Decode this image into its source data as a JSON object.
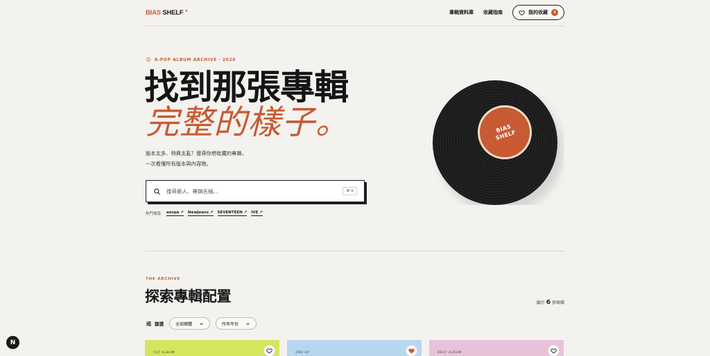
{
  "header": {
    "logo_a": "BIAS",
    "logo_b": "SHELF",
    "logo_dot": "●",
    "nav": [
      "專輯資料庫",
      "收藏指南"
    ],
    "favorites_label": "我的收藏",
    "favorites_count": "1"
  },
  "hero": {
    "eyebrow": "K-POP ALBUM ARCHIVE · 2026",
    "title_line1": "找到那張專輯",
    "title_line2": "完整的樣子。",
    "subtitle_line1": "版本太多、特典太亂？搜尋你想收藏的專輯，",
    "subtitle_line2": "一次看懂所有版本與內容物。",
    "search_placeholder": "搜尋藝人、專輯名稱...",
    "search_shortcut": "⌘ K",
    "popular_label": "熱門搜尋",
    "popular_tags": [
      "aespa ↗",
      "NewJeans ↗",
      "SEVENTEEN ↗",
      "IVE ↗"
    ],
    "vinyl_label_line1": "BIAS",
    "vinyl_label_line2": "SHELF"
  },
  "archive": {
    "eyebrow": "THE ARCHIVE",
    "title": "探索專輯配置",
    "count_prefix": "顯示",
    "count_value": "6",
    "count_suffix": "張專輯",
    "filter_label": "篩選",
    "filter_group": "全部團體",
    "filter_year": "所有年份",
    "cards": [
      {
        "meta": "1ST ALBUM",
        "color": "#d4e65c",
        "favorited": false
      },
      {
        "meta": "2ND EP",
        "color": "#b8d6f0",
        "favorited": true
      },
      {
        "meta": "BEST ALBUM",
        "color": "#e6c3d9",
        "favorited": false
      }
    ]
  },
  "corner_badge": "N",
  "colors": {
    "accent": "#c85a34",
    "background": "#f4f2ee",
    "ink": "#1d1d1d"
  }
}
